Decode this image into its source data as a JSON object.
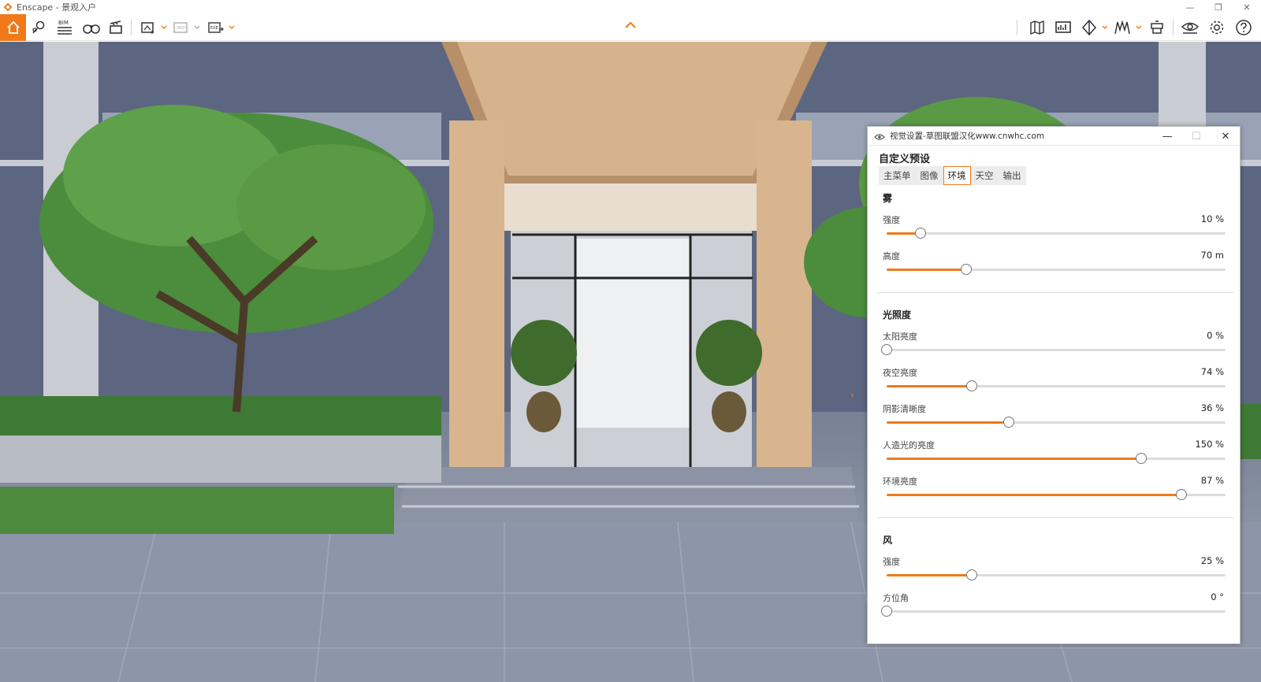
{
  "app": {
    "title": "Enscape - 景观入户",
    "window_controls": [
      "—",
      "❐",
      "✕"
    ]
  },
  "toolbar": {
    "left_tools": [
      {
        "name": "home",
        "icon": "home-icon"
      },
      {
        "name": "camera-views",
        "icon": "map-pin-icon"
      },
      {
        "name": "bim",
        "icon": "bim-icon",
        "label": "BIM"
      },
      {
        "name": "walk-mode",
        "icon": "binoculars-icon"
      },
      {
        "name": "video-editor",
        "icon": "clapperboard-icon"
      },
      {
        "name": "screenshot",
        "icon": "screenshot-icon"
      },
      {
        "name": "panorama",
        "icon": "panorama-360-icon",
        "label": "360°"
      },
      {
        "name": "export",
        "icon": "export-exe-icon",
        "label": "EXE"
      }
    ],
    "right_tools": [
      {
        "name": "map",
        "icon": "map-icon"
      },
      {
        "name": "presentation",
        "icon": "slides-icon"
      },
      {
        "name": "section",
        "icon": "section-icon"
      },
      {
        "name": "asset-library",
        "icon": "asset-library-icon"
      },
      {
        "name": "material",
        "icon": "material-icon"
      },
      {
        "name": "visual-settings",
        "icon": "eye-icon"
      },
      {
        "name": "settings",
        "icon": "gear-icon"
      },
      {
        "name": "help",
        "icon": "help-icon"
      }
    ],
    "accent_color": "#f07a1a"
  },
  "panel": {
    "title": "视觉设置-草图联盟汉化www.cnwhc.com",
    "controls": [
      "—",
      "☐",
      "✕"
    ],
    "preset": "自定义预设",
    "tabs": [
      {
        "label": "主菜单",
        "active": false
      },
      {
        "label": "图像",
        "active": false
      },
      {
        "label": "环境",
        "active": true
      },
      {
        "label": "天空",
        "active": false
      },
      {
        "label": "输出",
        "active": false
      }
    ],
    "sections": [
      {
        "title": "雾",
        "sliders": [
          {
            "label": "强度",
            "value": "10 %",
            "fraction": 0.1
          },
          {
            "label": "高度",
            "value": "70 m",
            "fraction": 0.235
          }
        ]
      },
      {
        "title": "光照度",
        "sliders": [
          {
            "label": "太阳亮度",
            "value": "0 %",
            "fraction": 0.0
          },
          {
            "label": "夜空亮度",
            "value": "74 %",
            "fraction": 0.25
          },
          {
            "label": "阴影清晰度",
            "value": "36 %",
            "fraction": 0.36
          },
          {
            "label": "人造光的亮度",
            "value": "150 %",
            "fraction": 0.75
          },
          {
            "label": "环境亮度",
            "value": "87 %",
            "fraction": 0.87
          }
        ]
      },
      {
        "title": "风",
        "sliders": [
          {
            "label": "强度",
            "value": "25 %",
            "fraction": 0.25
          },
          {
            "label": "方位角",
            "value": "0 °",
            "fraction": 0.0
          }
        ]
      }
    ]
  }
}
